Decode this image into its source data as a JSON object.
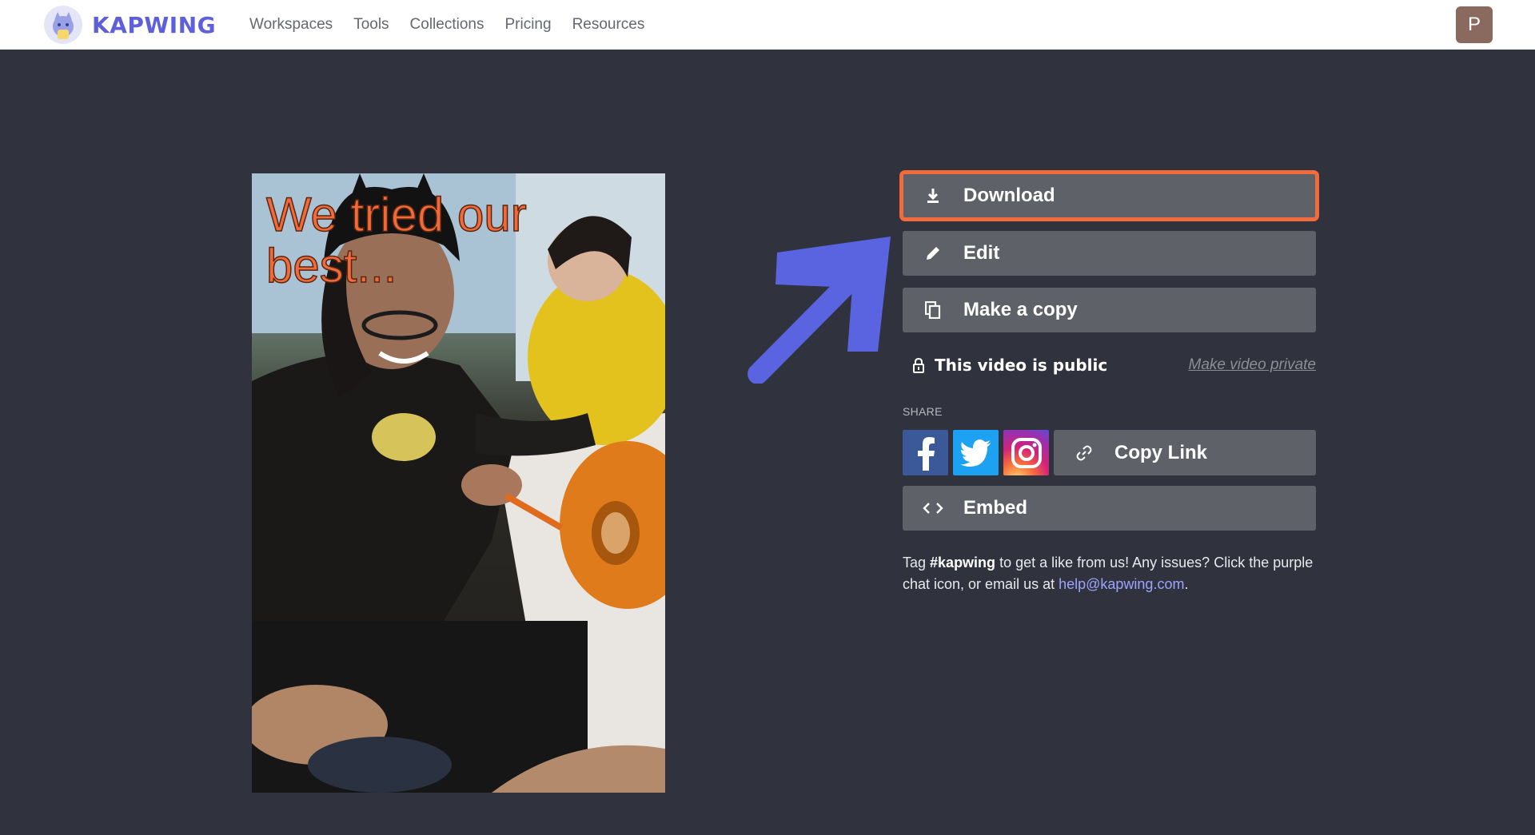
{
  "brand": {
    "name": "KAPWING",
    "color": "#5d5fdb"
  },
  "nav": {
    "items": [
      "Workspaces",
      "Tools",
      "Collections",
      "Pricing",
      "Resources"
    ]
  },
  "user": {
    "avatar_letter": "P"
  },
  "video": {
    "caption_line1": "We tried our",
    "caption_line2": "best..."
  },
  "actions": {
    "download_label": "Download",
    "edit_label": "Edit",
    "copy_label": "Make a copy",
    "highlight_color": "#f26b3a"
  },
  "privacy": {
    "status_text": "This video is public",
    "make_private_label": "Make video private"
  },
  "share": {
    "label": "SHARE",
    "networks": [
      "facebook",
      "twitter",
      "instagram"
    ],
    "copy_link_label": "Copy Link",
    "embed_label": "Embed"
  },
  "help": {
    "prefix": "Tag ",
    "hashtag": "#kapwing",
    "middle": " to get a like from us! Any issues? Click the purple chat icon, or email us at ",
    "email": "help@kapwing.com",
    "suffix": "."
  },
  "annotation": {
    "arrow_color": "#5a63e0"
  }
}
